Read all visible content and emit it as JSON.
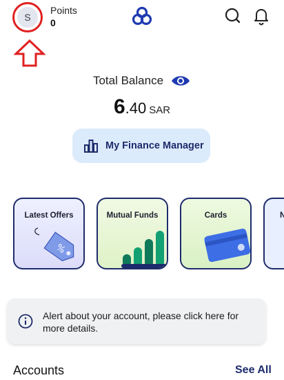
{
  "header": {
    "avatar_initial": "S",
    "points_label": "Points",
    "points_value": "0"
  },
  "balance": {
    "label": "Total Balance",
    "amount_integer": "6",
    "amount_decimal": ".40",
    "currency": "SAR"
  },
  "finance_manager": {
    "label": "My Finance Manager"
  },
  "quick_tiles": [
    {
      "label": "Latest Offers"
    },
    {
      "label": "Mutual Funds"
    },
    {
      "label": "Cards"
    },
    {
      "label": "N"
    }
  ],
  "alert": {
    "text": "Alert about your account, please click here for more details."
  },
  "accounts": {
    "title": "Accounts",
    "see_all": "See All"
  },
  "colors": {
    "brand_navy": "#1d2b6b",
    "brand_blue": "#1f3ab0",
    "annotation_red": "#e02020",
    "fm_button_bg": "#dcebfb"
  },
  "icons": [
    "logo-icon",
    "search-icon",
    "bell-icon",
    "eye-icon",
    "chart-icon",
    "info-icon",
    "up-arrow-annotation"
  ]
}
